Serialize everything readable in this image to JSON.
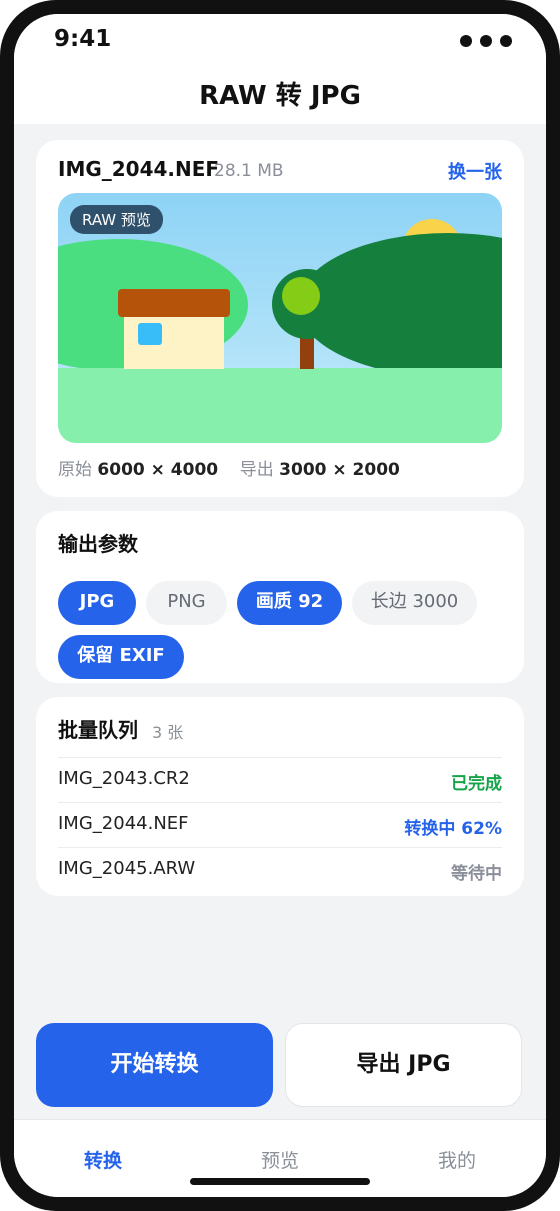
{
  "status_bar": {
    "time": "9:41"
  },
  "header": {
    "title": "RAW 转 JPG"
  },
  "file_card": {
    "filename": "IMG_2044.NEF",
    "size": "28.1 MB",
    "swap_label": "换一张",
    "preview_badge": "RAW 预览",
    "original_label": "原始",
    "original_dims": "6000 × 4000",
    "export_label": "导出",
    "export_dims": "3000 × 2000"
  },
  "output_params": {
    "title": "输出参数",
    "chips": [
      {
        "label": "JPG",
        "selected": true
      },
      {
        "label": "PNG",
        "selected": false
      },
      {
        "label": "画质 92",
        "selected": true
      },
      {
        "label": "长边 3000",
        "selected": false
      },
      {
        "label": "保留 EXIF",
        "selected": true
      }
    ]
  },
  "queue": {
    "title": "批量队列",
    "count": "3 张",
    "items": [
      {
        "name": "IMG_2043.CR2",
        "status": "已完成",
        "status_color": "#16a34a"
      },
      {
        "name": "IMG_2044.NEF",
        "status": "转换中 62%",
        "status_color": "#2563eb"
      },
      {
        "name": "IMG_2045.ARW",
        "status": "等待中",
        "status_color": "#8a8f99"
      }
    ]
  },
  "actions": {
    "start": "开始转换",
    "export": "导出 JPG"
  },
  "tabbar": {
    "tabs": [
      {
        "label": "转换",
        "active": true
      },
      {
        "label": "预览",
        "active": false
      },
      {
        "label": "我的",
        "active": false
      }
    ]
  },
  "colors": {
    "accent": "#2563eb",
    "done": "#16a34a",
    "pending": "#8a8f99"
  }
}
